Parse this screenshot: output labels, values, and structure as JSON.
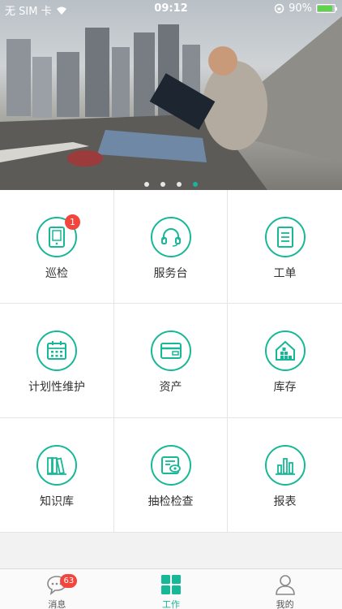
{
  "status_bar": {
    "carrier": "无 SIM 卡",
    "time": "09:12",
    "battery": "90%",
    "battery_level": 0.9
  },
  "banner": {
    "slide_count": 4,
    "active_slide": 4
  },
  "modules": [
    {
      "label": "巡检",
      "icon": "tablet-icon",
      "badge": "1"
    },
    {
      "label": "服务台",
      "icon": "headset-icon"
    },
    {
      "label": "工单",
      "icon": "document-icon"
    },
    {
      "label": "计划性维护",
      "icon": "calendar-icon"
    },
    {
      "label": "资产",
      "icon": "card-icon"
    },
    {
      "label": "库存",
      "icon": "warehouse-icon"
    },
    {
      "label": "知识库",
      "icon": "books-icon"
    },
    {
      "label": "抽检检查",
      "icon": "inspect-icon"
    },
    {
      "label": "报表",
      "icon": "bar-chart-icon"
    }
  ],
  "tabbar": {
    "tabs": [
      {
        "label": "消息",
        "icon": "chat-icon",
        "badge": "63"
      },
      {
        "label": "工作",
        "icon": "grid-icon",
        "active": true
      },
      {
        "label": "我的",
        "icon": "user-icon"
      }
    ]
  },
  "colors": {
    "accent": "#17b897",
    "badge": "#f2453d",
    "divider": "#e5e5e5"
  }
}
